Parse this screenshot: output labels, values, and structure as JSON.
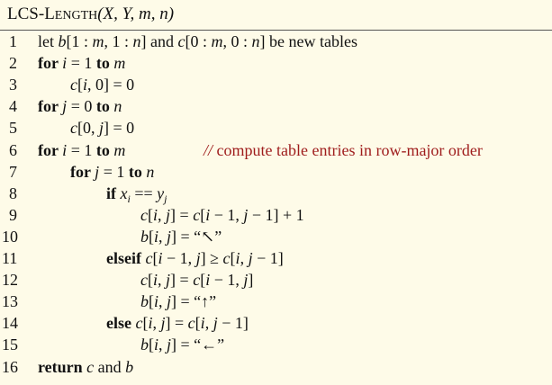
{
  "title": {
    "name_first": "LCS",
    "name_dash": "-",
    "name_L": "L",
    "name_rest": "ENGTH",
    "args": "(X, Y, m, n)"
  },
  "lines": [
    {
      "num": "1",
      "indent": 0,
      "parts": [
        {
          "t": "let "
        },
        {
          "t": "b",
          "s": "v"
        },
        {
          "t": "[1 : "
        },
        {
          "t": "m",
          "s": "v"
        },
        {
          "t": ", 1 : "
        },
        {
          "t": "n",
          "s": "v"
        },
        {
          "t": "] and "
        },
        {
          "t": "c",
          "s": "v"
        },
        {
          "t": "[0 : "
        },
        {
          "t": "m",
          "s": "v"
        },
        {
          "t": ", 0 : "
        },
        {
          "t": "n",
          "s": "v"
        },
        {
          "t": "] be new tables"
        }
      ]
    },
    {
      "num": "2",
      "indent": 0,
      "parts": [
        {
          "t": "for ",
          "s": "kw"
        },
        {
          "t": "i",
          "s": "v"
        },
        {
          "t": " = 1 "
        },
        {
          "t": "to ",
          "s": "kw"
        },
        {
          "t": "m",
          "s": "v"
        }
      ]
    },
    {
      "num": "3",
      "indent": 1,
      "parts": [
        {
          "t": "c",
          "s": "v"
        },
        {
          "t": "["
        },
        {
          "t": "i",
          "s": "v"
        },
        {
          "t": ", 0] = 0"
        }
      ]
    },
    {
      "num": "4",
      "indent": 0,
      "parts": [
        {
          "t": "for ",
          "s": "kw"
        },
        {
          "t": "j",
          "s": "v"
        },
        {
          "t": " = 0 "
        },
        {
          "t": "to ",
          "s": "kw"
        },
        {
          "t": "n",
          "s": "v"
        }
      ]
    },
    {
      "num": "5",
      "indent": 1,
      "parts": [
        {
          "t": "c",
          "s": "v"
        },
        {
          "t": "[0, "
        },
        {
          "t": "j",
          "s": "v"
        },
        {
          "t": "] = 0"
        }
      ]
    },
    {
      "num": "6",
      "indent": 0,
      "parts": [
        {
          "t": "for ",
          "s": "kw"
        },
        {
          "t": "i",
          "s": "v"
        },
        {
          "t": " = 1 "
        },
        {
          "t": "to ",
          "s": "kw"
        },
        {
          "t": "m",
          "s": "v"
        }
      ],
      "comment": "compute table entries in row-major order",
      "comment_prefix": "//"
    },
    {
      "num": "7",
      "indent": 1,
      "parts": [
        {
          "t": "for ",
          "s": "kw"
        },
        {
          "t": "j",
          "s": "v"
        },
        {
          "t": " = 1 "
        },
        {
          "t": "to ",
          "s": "kw"
        },
        {
          "t": "n",
          "s": "v"
        }
      ]
    },
    {
      "num": "8",
      "indent": 2,
      "parts": [
        {
          "t": "if ",
          "s": "kw"
        },
        {
          "t": "x",
          "s": "v"
        },
        {
          "t": "i",
          "s": "sub"
        },
        {
          "t": " == "
        },
        {
          "t": "y",
          "s": "v"
        },
        {
          "t": "j",
          "s": "sub"
        }
      ]
    },
    {
      "num": "9",
      "indent": 3,
      "parts": [
        {
          "t": "c",
          "s": "v"
        },
        {
          "t": "["
        },
        {
          "t": "i",
          "s": "v"
        },
        {
          "t": ", "
        },
        {
          "t": "j",
          "s": "v"
        },
        {
          "t": "] = "
        },
        {
          "t": "c",
          "s": "v"
        },
        {
          "t": "["
        },
        {
          "t": "i",
          "s": "v"
        },
        {
          "t": " − 1, "
        },
        {
          "t": "j",
          "s": "v"
        },
        {
          "t": " − 1] + 1"
        }
      ]
    },
    {
      "num": "10",
      "indent": 3,
      "parts": [
        {
          "t": "b",
          "s": "v"
        },
        {
          "t": "["
        },
        {
          "t": "i",
          "s": "v"
        },
        {
          "t": ", "
        },
        {
          "t": "j",
          "s": "v"
        },
        {
          "t": "] = “↖”"
        }
      ]
    },
    {
      "num": "11",
      "indent": 2,
      "parts": [
        {
          "t": "elseif ",
          "s": "kw"
        },
        {
          "t": "c",
          "s": "v"
        },
        {
          "t": "["
        },
        {
          "t": "i",
          "s": "v"
        },
        {
          "t": " − 1, "
        },
        {
          "t": "j",
          "s": "v"
        },
        {
          "t": "] ≥ "
        },
        {
          "t": "c",
          "s": "v"
        },
        {
          "t": "["
        },
        {
          "t": "i",
          "s": "v"
        },
        {
          "t": ", "
        },
        {
          "t": "j",
          "s": "v"
        },
        {
          "t": " − 1]"
        }
      ]
    },
    {
      "num": "12",
      "indent": 3,
      "parts": [
        {
          "t": "c",
          "s": "v"
        },
        {
          "t": "["
        },
        {
          "t": "i",
          "s": "v"
        },
        {
          "t": ", "
        },
        {
          "t": "j",
          "s": "v"
        },
        {
          "t": "] = "
        },
        {
          "t": "c",
          "s": "v"
        },
        {
          "t": "["
        },
        {
          "t": "i",
          "s": "v"
        },
        {
          "t": " − 1, "
        },
        {
          "t": "j",
          "s": "v"
        },
        {
          "t": "]"
        }
      ]
    },
    {
      "num": "13",
      "indent": 3,
      "parts": [
        {
          "t": "b",
          "s": "v"
        },
        {
          "t": "["
        },
        {
          "t": "i",
          "s": "v"
        },
        {
          "t": ", "
        },
        {
          "t": "j",
          "s": "v"
        },
        {
          "t": "] = “↑”"
        }
      ]
    },
    {
      "num": "14",
      "indent": 2,
      "parts": [
        {
          "t": "else ",
          "s": "kw"
        },
        {
          "t": "c",
          "s": "v"
        },
        {
          "t": "["
        },
        {
          "t": "i",
          "s": "v"
        },
        {
          "t": ", "
        },
        {
          "t": "j",
          "s": "v"
        },
        {
          "t": "] = "
        },
        {
          "t": "c",
          "s": "v"
        },
        {
          "t": "["
        },
        {
          "t": "i",
          "s": "v"
        },
        {
          "t": ", "
        },
        {
          "t": "j",
          "s": "v"
        },
        {
          "t": " − 1]"
        }
      ]
    },
    {
      "num": "15",
      "indent": 3,
      "parts": [
        {
          "t": "b",
          "s": "v"
        },
        {
          "t": "["
        },
        {
          "t": "i",
          "s": "v"
        },
        {
          "t": ", "
        },
        {
          "t": "j",
          "s": "v"
        },
        {
          "t": "] = “←”"
        }
      ]
    },
    {
      "num": "16",
      "indent": 0,
      "parts": [
        {
          "t": "return ",
          "s": "kw"
        },
        {
          "t": "c",
          "s": "v"
        },
        {
          "t": " and "
        },
        {
          "t": "b",
          "s": "v"
        }
      ]
    }
  ]
}
